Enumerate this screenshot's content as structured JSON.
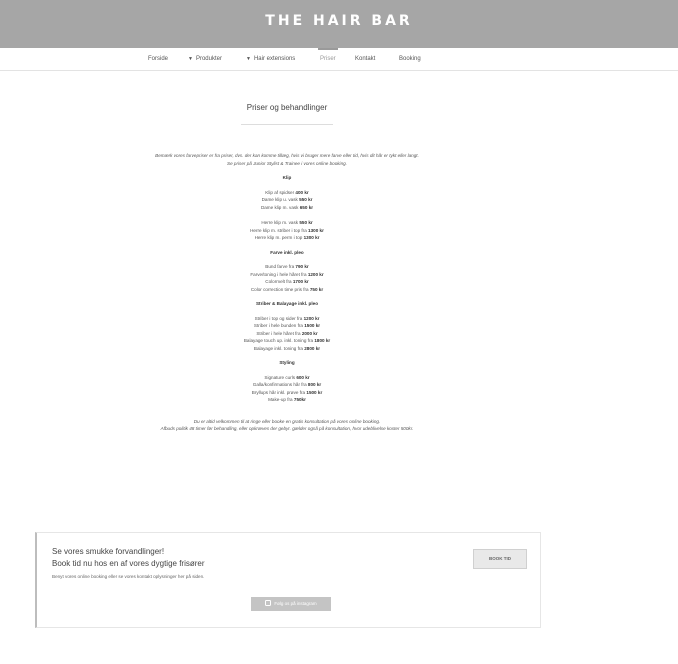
{
  "header": {
    "title": "THE HAIR BAR"
  },
  "nav": {
    "items": [
      {
        "label": "Forside",
        "caret": false,
        "active": false
      },
      {
        "label": "Produkter",
        "caret": true,
        "active": false
      },
      {
        "label": "Hair extensions",
        "caret": true,
        "active": false
      },
      {
        "label": "Priser",
        "caret": false,
        "active": true
      },
      {
        "label": "Kontakt",
        "caret": false,
        "active": false
      },
      {
        "label": "Booking",
        "caret": false,
        "active": false
      }
    ]
  },
  "page": {
    "heading": "Priser og behandlinger"
  },
  "content": {
    "note1": "Bemærk vores farvepriser er fra priser, dvs. der kan komme tillæg, hvis vi bruger mere farve eller tid, hvis dit hår er tykt eller langt.",
    "note2": "Se priser på Junior Stylist & Trainee i vores online booking.",
    "sections": [
      {
        "title": "Klip",
        "groups": [
          [
            {
              "label": "Klip af spidser",
              "price": "400 kr"
            },
            {
              "label": "Dame klip u. vask",
              "price": "550 kr"
            },
            {
              "label": "Dame klip m. vask",
              "price": "650 kr"
            }
          ],
          [
            {
              "label": "Herre klip m. vask",
              "price": "550 kr"
            },
            {
              "label": "Herre klip m. striber i top fra",
              "price": "1300 kr"
            },
            {
              "label": "Herre klip m. perm i top",
              "price": "1300 kr"
            }
          ]
        ]
      },
      {
        "title": "Farve inkl. pleo",
        "groups": [
          [
            {
              "label": "Bund farve fra",
              "price": "790 kr"
            },
            {
              "label": "Farve/toning i hele håret fra",
              "price": "1200 kr"
            },
            {
              "label": "Colormelt fra",
              "price": "1700 kr"
            },
            {
              "label": "Color correction time pris fra",
              "price": "750 kr"
            }
          ]
        ]
      },
      {
        "title": "Striber & Balayage inkl. pleo",
        "groups": [
          [
            {
              "label": "Striber i top og sider fra",
              "price": "1200 kr"
            },
            {
              "label": "Striber i hele bunden fra",
              "price": "1500 kr"
            },
            {
              "label": "Striber i hele håret fra",
              "price": "2000 kr"
            },
            {
              "label": "Balayage touch up. inkl. toning fra",
              "price": "1800 kr"
            },
            {
              "label": "Balayage inkl. toning fra",
              "price": "2800 kr"
            }
          ]
        ]
      },
      {
        "title": "Styling",
        "groups": [
          [
            {
              "label": "Signature curls",
              "price": "600 kr"
            },
            {
              "label": "Galla/konfirmations hår fra",
              "price": "800 kr"
            },
            {
              "label": "Bryllups hår inkl. prøve fra",
              "price": "1500 kr"
            },
            {
              "label": "Make-up fra",
              "price": "750kr"
            }
          ]
        ]
      }
    ],
    "footer1": "Du er altid velkommen til at ringe eller booke en gratis konsultation på vores online booking.",
    "footer2": "Afbuds politik 48 timer før behandling, eller opkræves der gebyr. gælder også på konsultation, hvor udeblivelse koster 500kr."
  },
  "cta": {
    "line1": "Se vores smukke forvandlinger!",
    "line2": "Book tid nu hos en af vores dygtige frisører",
    "small": "Benyt vores online booking eller se vores kontakt oplysninger her på siden.",
    "book_label": "BOOK TID",
    "instagram_label": "Følg os på instagram"
  }
}
